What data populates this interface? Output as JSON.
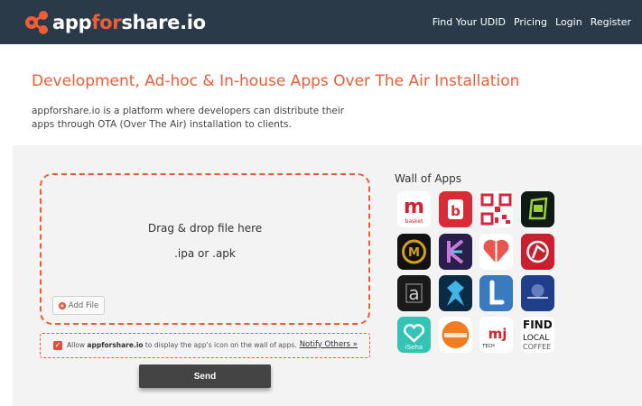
{
  "header": {
    "logo_prefix": "app",
    "logo_accent": "for",
    "logo_suffix": "share.io",
    "nav": [
      "Find Your UDID",
      "Pricing",
      "Login",
      "Register"
    ]
  },
  "intro": {
    "headline": "Development, Ad-hoc & In-house Apps Over The Air Installation",
    "description": "appforshare.io is a platform where developers can distribute their apps through OTA (Over The Air) installation to clients."
  },
  "upload": {
    "drop_text": "Drag & drop file here",
    "extensions": ".ipa or .apk",
    "add_file": "Add File",
    "allow_prefix": "Allow ",
    "allow_brand": "appforshare.io",
    "allow_suffix": " to display the app's icon on the wall of apps.",
    "notify_others": "Notify Others »",
    "send": "Send"
  },
  "wall": {
    "title": "Wall of Apps",
    "apps": [
      "m basket",
      "b",
      "qr",
      "gc",
      "m",
      "k",
      "heart",
      "r",
      "a",
      "fish",
      "l",
      "moonlight",
      "iseha",
      "circle",
      "mj tech",
      "find local coffee"
    ]
  },
  "colors": {
    "accent": "#ef5d36",
    "header_bg": "#2b3a48",
    "send_bg": "#444444"
  }
}
